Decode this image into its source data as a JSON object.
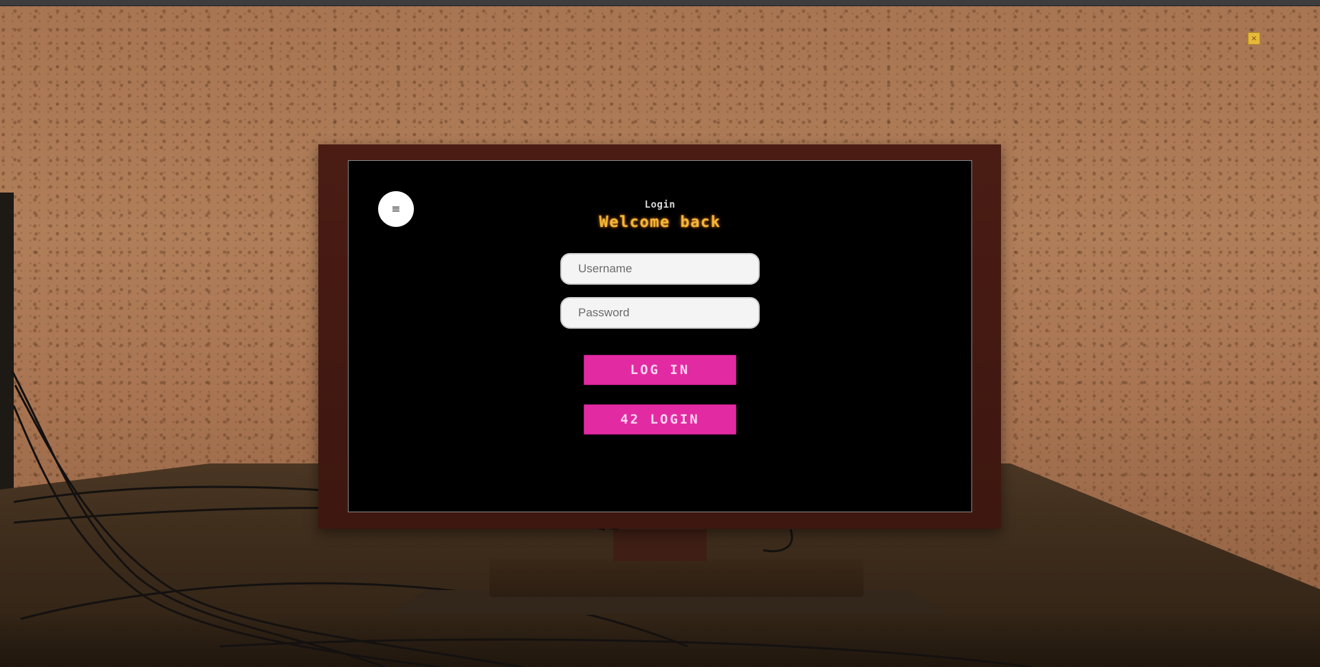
{
  "window": {
    "close_label": "×"
  },
  "screen": {
    "menu_icon_glyph": "≡",
    "small_title": "Login",
    "big_title": "Welcome back",
    "username_placeholder": "Username",
    "password_placeholder": "Password",
    "login_button": "LOG IN",
    "login_42_button": "42 LOGIN"
  },
  "colors": {
    "accent_pink": "#e22aa2",
    "title_gold": "#f0b83a",
    "wall": "#a87552",
    "bezel": "#4a1c14"
  }
}
